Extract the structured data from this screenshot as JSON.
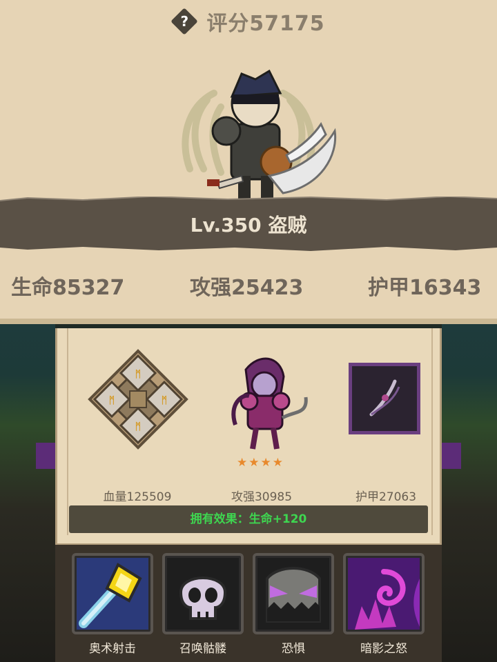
{
  "header": {
    "help_icon": "question-diamond-icon",
    "score_label": "评分57175"
  },
  "hero": {
    "level_label": "Lv.350 盗贼"
  },
  "stats": {
    "hp": "生命85327",
    "attack": "攻强25423",
    "armor": "护甲16343"
  },
  "equipment": {
    "rune_label": "血量125509",
    "companion_label": "攻强30985",
    "companion_stars": 4,
    "bow_label": "护甲27063",
    "effect": "拥有效果：生命+120"
  },
  "skills": [
    {
      "name": "奥术射击",
      "icon": "arcane-staff-icon"
    },
    {
      "name": "召唤骷髅",
      "icon": "skull-icon"
    },
    {
      "name": "恐惧",
      "icon": "fear-mask-icon"
    },
    {
      "name": "暗影之怒",
      "icon": "shadow-fury-icon"
    }
  ],
  "colors": {
    "panel": "#e6d4b5",
    "band": "#5a5146",
    "effect_text": "#3ed650",
    "star": "#e8892c"
  }
}
